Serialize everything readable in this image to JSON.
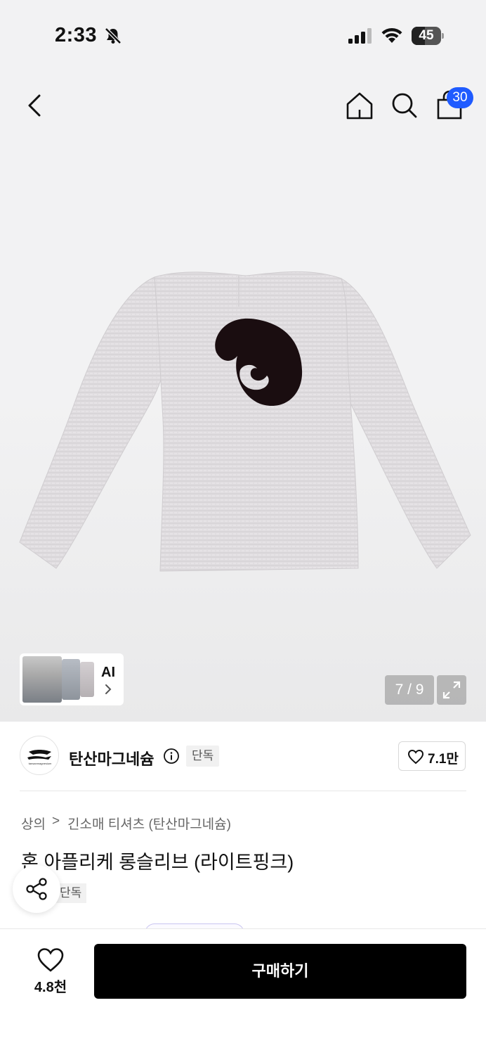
{
  "status_bar": {
    "time": "2:33",
    "battery": "45",
    "battery_fraction": 0.45
  },
  "nav": {
    "cart_count": "30"
  },
  "gallery": {
    "ai_label": "AI",
    "page_indicator": "7 / 9"
  },
  "brand": {
    "name": "탄산마그네슘",
    "tag": "단독",
    "like_count": "7.1만",
    "logo_text": "tansanmagnesium"
  },
  "breadcrumb": {
    "level1": "상의",
    "separator": ">",
    "level2": "긴소매 티셔츠 (탄산마그네슘)"
  },
  "product": {
    "title": "혼 아플리케 롱슬리브 (라이트핑크)",
    "tag": "단독"
  },
  "bottom_bar": {
    "like_count": "4.8천",
    "buy_label": "구매하기"
  },
  "colors": {
    "badge": "#1f5bff",
    "buy_button": "#000000",
    "shirt": "#e2dfe1",
    "applique": "#1a0d10"
  },
  "icons": [
    "bell-slash-icon",
    "signal-icon",
    "wifi-icon",
    "back-icon",
    "home-icon",
    "search-icon",
    "shopping-bag-icon",
    "chevron-right-icon",
    "expand-icon",
    "info-icon",
    "heart-icon",
    "share-icon"
  ]
}
